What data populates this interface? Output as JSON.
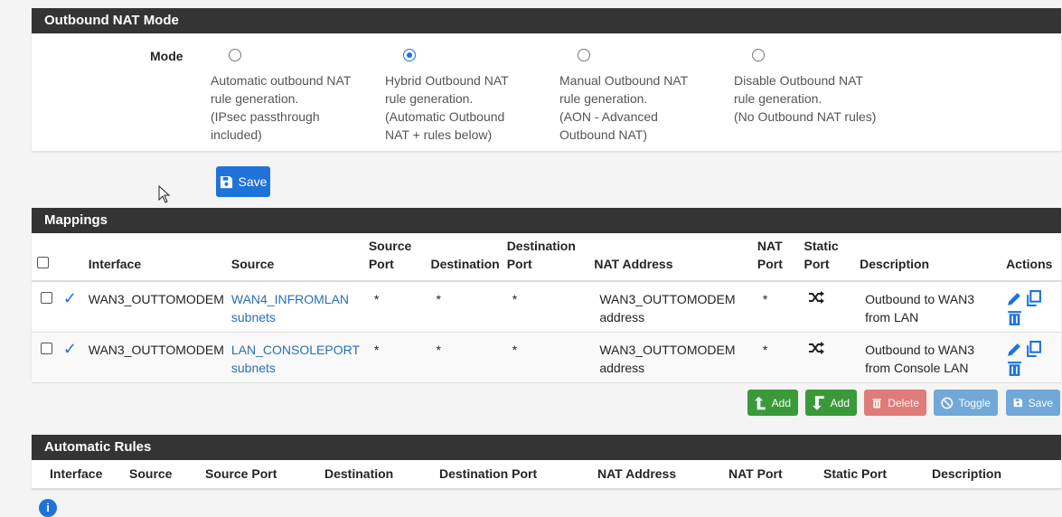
{
  "nat_mode": {
    "title": "Outbound NAT Mode",
    "mode_label": "Mode",
    "options": [
      {
        "lines": [
          "Automatic outbound NAT",
          "rule generation.",
          "(IPsec passthrough",
          "included)"
        ],
        "checked": false
      },
      {
        "lines": [
          "Hybrid Outbound NAT",
          "rule generation.",
          "(Automatic Outbound",
          "NAT + rules below)"
        ],
        "checked": true
      },
      {
        "lines": [
          "Manual Outbound NAT",
          "rule generation.",
          "(AON - Advanced",
          "Outbound NAT)"
        ],
        "checked": false
      },
      {
        "lines": [
          "Disable Outbound NAT",
          "rule generation.",
          "(No Outbound NAT rules)"
        ],
        "checked": false
      }
    ],
    "save_label": "Save"
  },
  "mappings": {
    "title": "Mappings",
    "headers": {
      "interface": "Interface",
      "source": "Source",
      "source_port_1": "Source",
      "source_port_2": "Port",
      "destination": "Destination",
      "destination_port_1": "Destination",
      "destination_port_2": "Port",
      "nat_address": "NAT Address",
      "nat_port_1": "NAT",
      "nat_port_2": "Port",
      "static_port_1": "Static",
      "static_port_2": "Port",
      "description": "Description",
      "actions": "Actions"
    },
    "rows": [
      {
        "interface": "WAN3_OUTTOMODEM",
        "source_1": "WAN4_INFROMLAN",
        "source_2": "subnets",
        "source_port": "*",
        "destination": "*",
        "destination_port": "*",
        "nat_address_1": "WAN3_OUTTOMODEM",
        "nat_address_2": "address",
        "nat_port": "*",
        "description_1": "Outbound to WAN3",
        "description_2": "from LAN"
      },
      {
        "interface": "WAN3_OUTTOMODEM",
        "source_1": "LAN_CONSOLEPORT",
        "source_2": "subnets",
        "source_port": "*",
        "destination": "*",
        "destination_port": "*",
        "nat_address_1": "WAN3_OUTTOMODEM",
        "nat_address_2": "address",
        "nat_port": "*",
        "description_1": "Outbound to WAN3",
        "description_2": "from Console LAN"
      }
    ],
    "buttons": {
      "add_top": "Add",
      "add_bottom": "Add",
      "delete": "Delete",
      "toggle": "Toggle",
      "save": "Save"
    }
  },
  "auto_rules": {
    "title": "Automatic Rules",
    "headers": [
      "Interface",
      "Source",
      "Source Port",
      "Destination",
      "Destination Port",
      "NAT Address",
      "NAT Port",
      "Static Port",
      "Description"
    ]
  },
  "colors": {
    "heading_bg": "#343434",
    "primary": "#1e73d8",
    "success": "#3a9a3a",
    "danger": "#d9534f",
    "link": "#2a6fb5"
  },
  "icons": {
    "save": "floppy-disk-icon",
    "selected": "checkmark-icon",
    "static_port": "shuffle-icon",
    "edit": "pencil-icon",
    "copy": "copy-icon",
    "delete": "trash-icon",
    "add_top": "arrow-up-icon",
    "add_bottom": "arrow-down-icon",
    "toggle": "ban-icon",
    "info": "info-icon"
  }
}
